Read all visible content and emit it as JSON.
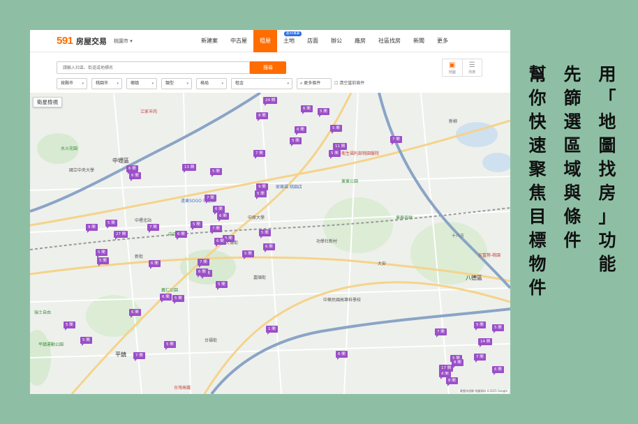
{
  "header": {
    "logo_text": "591",
    "logo_sub": "房屋交易",
    "city_selector": "桃園市 ▾",
    "nav": [
      {
        "label": "新建案"
      },
      {
        "label": "中古屋"
      },
      {
        "label": "租屋",
        "active": true
      },
      {
        "label": "土地",
        "badge": "超40萬筆"
      },
      {
        "label": "店面"
      },
      {
        "label": "辦公"
      },
      {
        "label": "廠房"
      },
      {
        "label": "社區找房"
      },
      {
        "label": "新聞"
      },
      {
        "label": "更多"
      }
    ]
  },
  "search": {
    "placeholder": "請輸入社區、街道或地標名",
    "button_label": "搜尋"
  },
  "view_toggle": {
    "map_label": "地圖",
    "list_label": "列表",
    "map_icon": "map-icon",
    "list_icon": "list-icon"
  },
  "filters": [
    {
      "label": "按縣市"
    },
    {
      "label": "桃園市"
    },
    {
      "label": "鄉鎮"
    },
    {
      "label": "類型"
    },
    {
      "label": "格局"
    },
    {
      "label": "租金"
    }
  ],
  "more_filters_label": "更多條件",
  "clear_label": "清空當前條件",
  "map": {
    "satellite_label": "衛星檢視",
    "attribution": "鍵盤快速鍵  地圖資料 ©2025 Google",
    "markers": [
      "24 間",
      "8 間",
      "6 間",
      "5 間",
      "6 間",
      "7 間",
      "5 間",
      "5 間",
      "11 間",
      "5 間",
      "7 間",
      "6 間",
      "13 間",
      "5 間",
      "6 間",
      "9 間",
      "5 間",
      "7 間",
      "6 間",
      "5 間",
      "6 間",
      "7 間",
      "5 間",
      "9 間",
      "7 間",
      "6 間",
      "6 間",
      "27 間",
      "5 間",
      "5 間",
      "6 間",
      "6 間",
      "7 間",
      "5 間",
      "5 間",
      "6 間",
      "5 間",
      "6 間",
      "6 間",
      "5 間",
      "6 間",
      "5 間",
      "5 間",
      "5 間",
      "5 間",
      "7 間",
      "7 間",
      "5 間",
      "5 間",
      "8 間",
      "17 間",
      "14 間",
      "6 間",
      "8 間",
      "8 間",
      "1 間",
      "7 間",
      "6 間",
      "5 間"
    ],
    "places": {
      "zhongli": "中壢區",
      "bade": "八德區",
      "pingzhen": "平鎮",
      "jiangcui": "江家羊肉",
      "shuihuohua": "水火花園",
      "guoli": "國立中央大學",
      "zhongyuan": "中原大學",
      "sogo": "遠東SOGO 中壢店",
      "yiren": "義仁公園",
      "dongxing": "東泰羽球",
      "zhongmin": "中華民國高專科學校",
      "wenhua": "台灣高鐵",
      "jiale": "家樂福 桃園店",
      "laiyi": "衛生福利部桃園醫院",
      "zhongzheng": "中正公園",
      "xinjie": "新街",
      "dongdong": "東東公園",
      "gongjia": "功學社新村",
      "daan": "大安",
      "shishi": "十八方",
      "anfu": "安富勢-桃園",
      "dalun": "大倫街",
      "jiachun": "嘉順街",
      "zhongbei": "中壢北站",
      "pingzhen_arena": "平鎮運動公園",
      "ruijin": "瑞士自由",
      "xinliu": "新柳",
      "taifu": "台福街"
    }
  },
  "headline": {
    "col1": [
      "用",
      "「",
      "地",
      "圖",
      "找",
      "房",
      "」",
      "功",
      "能"
    ],
    "col2": [
      "先",
      "篩",
      "選",
      "區",
      "域",
      "與",
      "條",
      "件"
    ],
    "col3": [
      "幫",
      "你",
      "快",
      "速",
      "聚",
      "焦",
      "目",
      "標",
      "物",
      "件"
    ]
  }
}
